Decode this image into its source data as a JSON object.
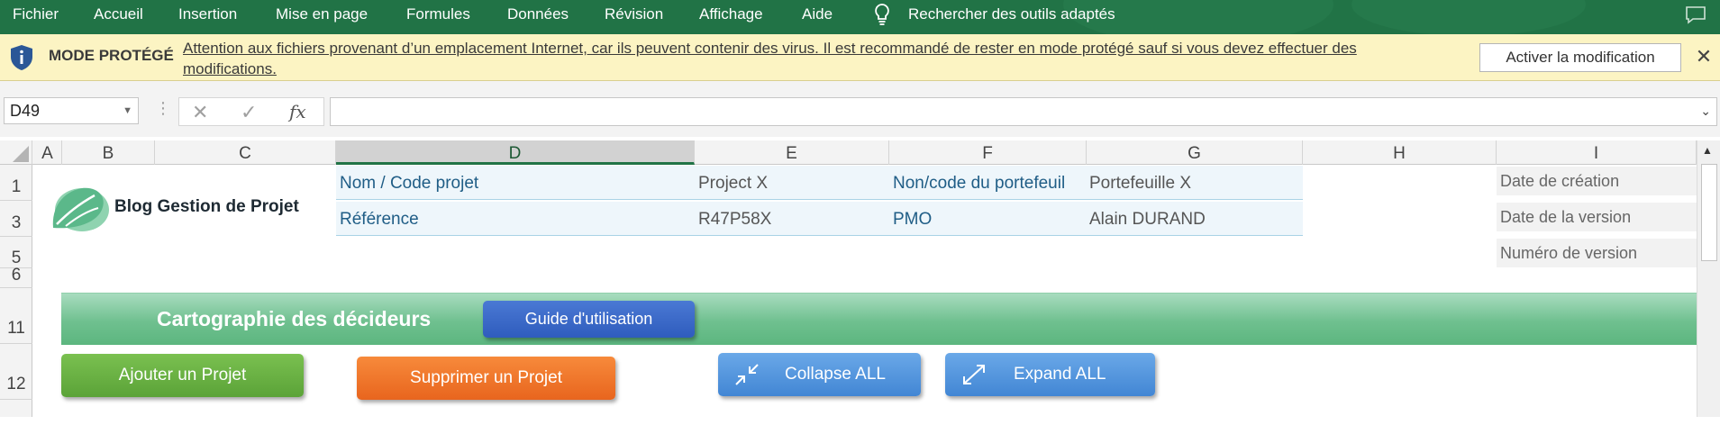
{
  "menu": {
    "items": [
      "Fichier",
      "Accueil",
      "Insertion",
      "Mise en page",
      "Formules",
      "Données",
      "Révision",
      "Affichage",
      "Aide"
    ],
    "search_label": "Rechercher des outils adaptés",
    "search_icon": "lightbulb-icon",
    "comment_icon": "comment-icon"
  },
  "protected": {
    "icon": "shield-info-icon",
    "title": "MODE PROTÉGÉ",
    "message": "Attention aux fichiers provenant d’un emplacement Internet, car ils peuvent contenir des virus. Il est recommandé de rester en mode protégé sauf si vous devez effectuer des modifications.",
    "enable_button": "Activer la modification",
    "close_glyph": "✕"
  },
  "formula_bar": {
    "name_box": "D49",
    "separator": "⋮",
    "cancel_glyph": "✕",
    "enter_glyph": "✓",
    "fx_label": "fx",
    "formula": ""
  },
  "columns": [
    "A",
    "B",
    "C",
    "D",
    "E",
    "F",
    "G",
    "H",
    "I"
  ],
  "selected_column": "D",
  "rows": [
    "1",
    "3",
    "5",
    "6",
    "11",
    "12"
  ],
  "logo": {
    "text": "Blog Gestion de Projet",
    "colors": {
      "leaf_dark": "#5bb88a",
      "leaf_light": "#8fd3b0"
    }
  },
  "project_info": {
    "name_label": "Nom / Code projet",
    "name_value": "Project X",
    "portfolio_label": "Non/code du portefeuil",
    "portfolio_value": "Portefeuille X",
    "ref_label": "Référence",
    "ref_value": "R47P58X",
    "pmo_label": "PMO",
    "pmo_value": "Alain DURAND"
  },
  "side_info": [
    "Date de création",
    "Date de la version",
    "Numéro de version"
  ],
  "section": {
    "title": "Cartographie des décideurs",
    "guide_button": "Guide d'utilisation"
  },
  "actions": {
    "add": "Ajouter un Projet",
    "delete": "Supprimer un Projet",
    "collapse": "Collapse ALL",
    "expand": "Expand ALL",
    "collapse_icon": "collapse-arrows-icon",
    "expand_icon": "expand-arrows-icon"
  },
  "colors": {
    "excel_green": "#217346",
    "banner_yellow": "#fcf4c3",
    "label_blue": "#1f5d86",
    "button_blue": "#2f5cbd",
    "button_green": "#5ba338",
    "button_orange": "#e8651e",
    "button_light_blue": "#4286d4"
  }
}
